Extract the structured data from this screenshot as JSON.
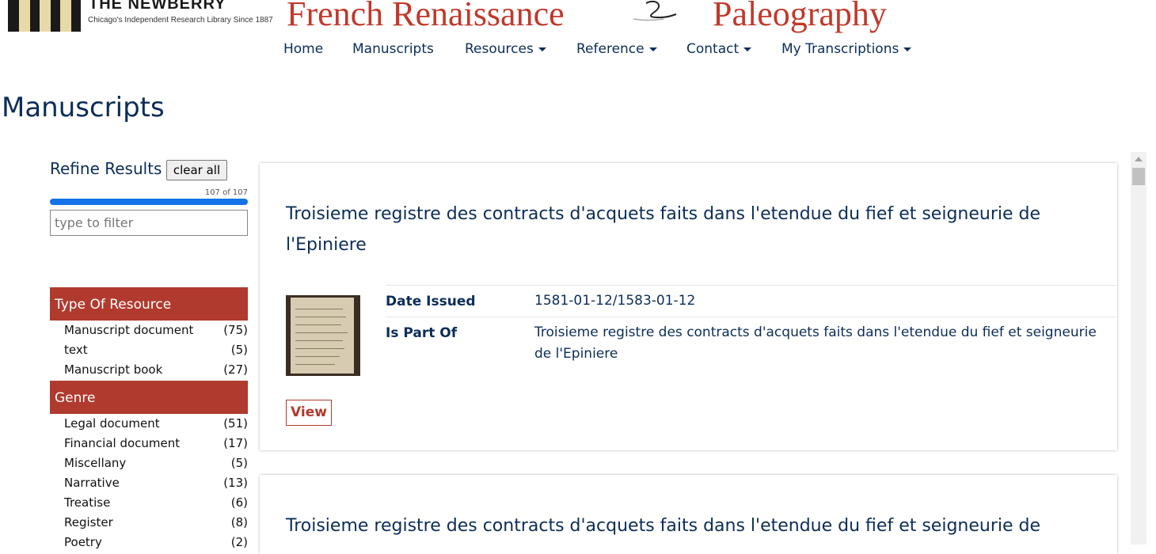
{
  "header": {
    "logo_name": "THE NEWBERRY",
    "logo_tagline": "Chicago's Independent Research Library Since 1887",
    "title_left": "French Renaissance",
    "title_right": "Paleography"
  },
  "nav": [
    {
      "label": "Home",
      "dropdown": false
    },
    {
      "label": "Manuscripts",
      "dropdown": false
    },
    {
      "label": "Resources",
      "dropdown": true
    },
    {
      "label": "Reference",
      "dropdown": true
    },
    {
      "label": "Contact",
      "dropdown": true
    },
    {
      "label": "My Transcriptions",
      "dropdown": true
    }
  ],
  "page_title": "Manuscripts",
  "sidebar": {
    "refine_label": "Refine Results",
    "clear_label": "clear all",
    "count_text": "107 of 107",
    "progress": 1.0,
    "filter_placeholder": "type to filter",
    "facets": [
      {
        "title": "Type Of Resource",
        "items": [
          {
            "name": "Manuscript document",
            "count": "(75)"
          },
          {
            "name": "text",
            "count": "(5)"
          },
          {
            "name": "Manuscript book",
            "count": "(27)"
          }
        ]
      },
      {
        "title": "Genre",
        "items": [
          {
            "name": "Legal document",
            "count": "(51)"
          },
          {
            "name": "Financial document",
            "count": "(17)"
          },
          {
            "name": "Miscellany",
            "count": "(5)"
          },
          {
            "name": "Narrative",
            "count": "(13)"
          },
          {
            "name": "Treatise",
            "count": "(6)"
          },
          {
            "name": "Register",
            "count": "(8)"
          },
          {
            "name": "Poetry",
            "count": "(2)"
          }
        ]
      }
    ]
  },
  "results": [
    {
      "title": "Troisieme registre des contracts d'acquets faits dans l'etendue du fief et seigneurie de l'Epiniere",
      "date_label": "Date Issued",
      "date_value": "1581-01-12/1583-01-12",
      "part_label": "Is Part Of",
      "part_value": "Troisieme registre des contracts d'acquets faits dans l'etendue du fief et seigneurie de l'Epiniere",
      "view_label": "View"
    },
    {
      "title": "Troisieme registre des contracts d'acquets faits dans l'etendue du fief et seigneurie de"
    }
  ],
  "colors": {
    "navy": "#0c2d57",
    "brand_red": "#c0392b",
    "facet_header": "#b03a2e",
    "progress_blue": "#1473e6"
  }
}
